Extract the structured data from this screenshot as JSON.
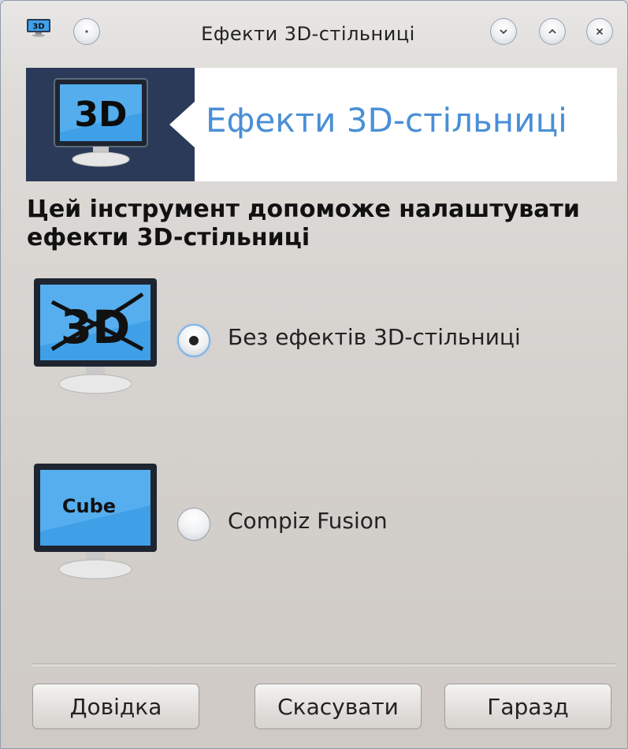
{
  "window": {
    "title": "Ефекти 3D-стільниці",
    "app_icon": "3d-monitor-icon"
  },
  "titlebar_buttons": [
    "menu-button",
    "minimize-button",
    "maximize-button",
    "close-button"
  ],
  "banner": {
    "icon_text": "3D",
    "title": "Ефекти 3D-стільниці"
  },
  "heading": "Цей інструмент допоможе налаштувати ефекти 3D-стільниці",
  "options": [
    {
      "icon": "no-3d-monitor-icon",
      "label": "Без ефектів 3D-стільниці",
      "checked": true
    },
    {
      "icon": "cube-monitor-icon",
      "icon_text": "Cube",
      "label": "Compiz Fusion",
      "checked": false
    }
  ],
  "buttons": {
    "help": "Довідка",
    "cancel": "Скасувати",
    "ok": "Гаразд"
  },
  "colors": {
    "banner_dark": "#2a3a58",
    "banner_title": "#4a8fd6",
    "screen_blue": "#3fa0e8"
  }
}
